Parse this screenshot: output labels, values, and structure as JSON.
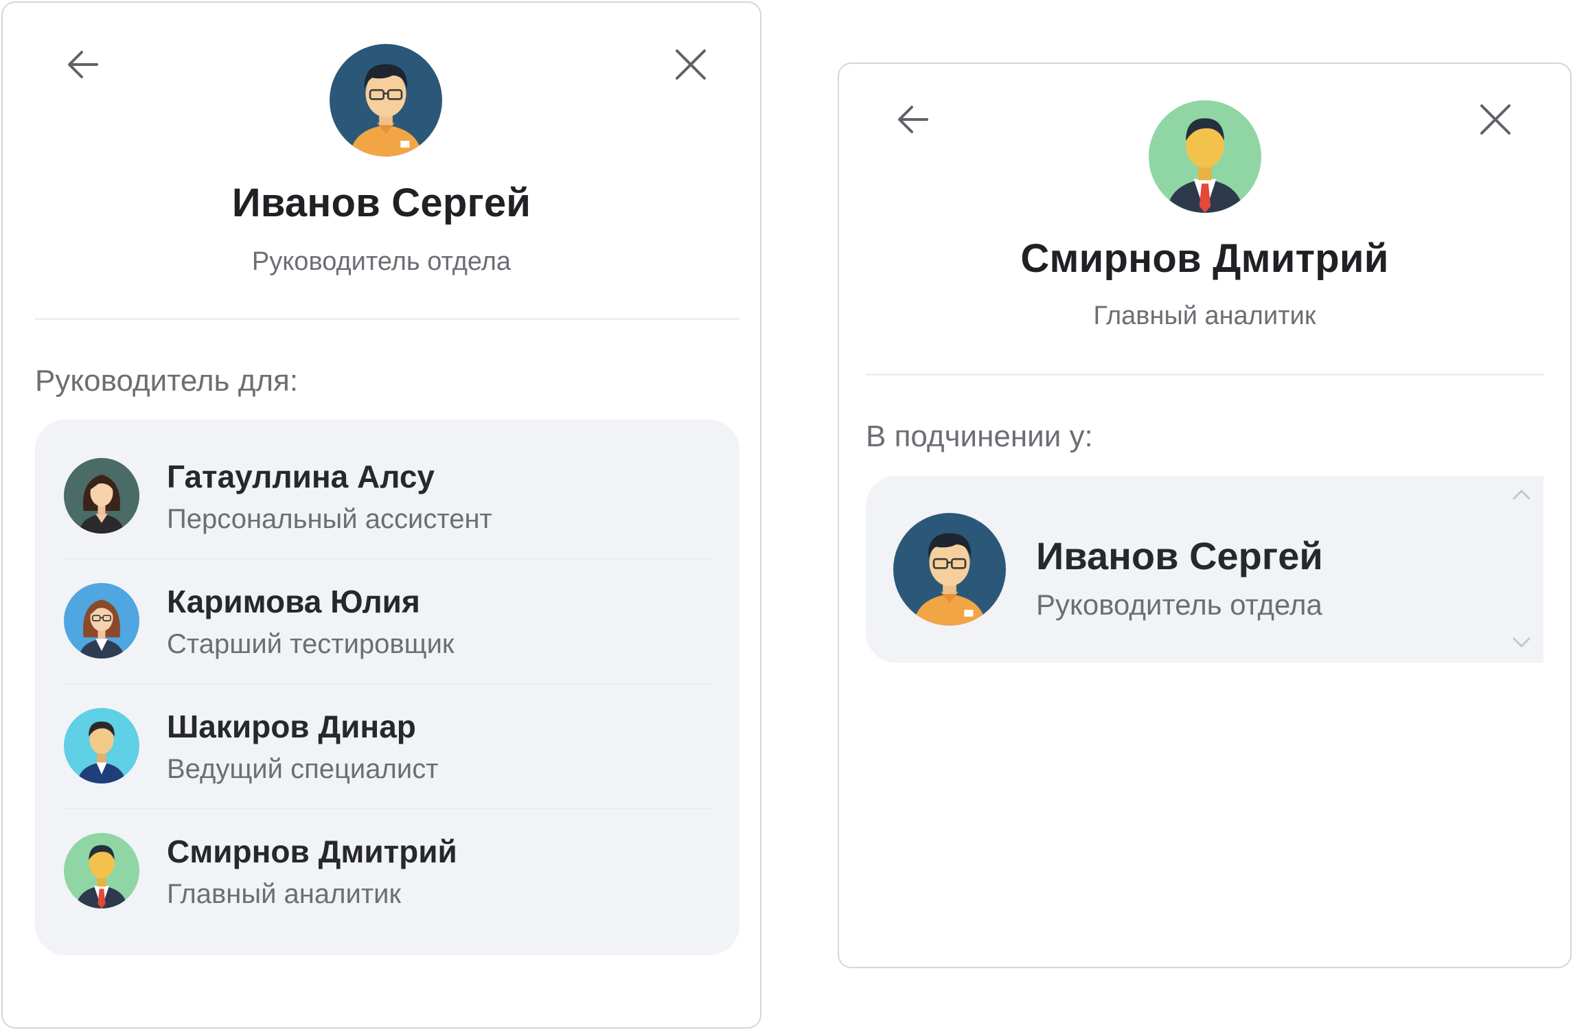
{
  "left_card": {
    "profile": {
      "name": "Иванов Сергей",
      "role": "Руководитель отдела",
      "avatar_icon": "man-glasses-orange-avatar"
    },
    "section_label": "Руководитель для:",
    "items": [
      {
        "name": "Гатауллина Алсу",
        "role": "Персональный ассистент",
        "avatar_icon": "woman-dark-hair-avatar"
      },
      {
        "name": "Каримова Юлия",
        "role": "Старший тестировщик",
        "avatar_icon": "woman-glasses-avatar"
      },
      {
        "name": "Шакиров Динар",
        "role": "Ведущий специалист",
        "avatar_icon": "man-blue-suit-avatar"
      },
      {
        "name": "Смирнов Дмитрий",
        "role": "Главный аналитик",
        "avatar_icon": "man-red-tie-avatar"
      }
    ],
    "back_icon": "arrow-left-icon",
    "close_icon": "close-icon"
  },
  "right_card": {
    "profile": {
      "name": "Смирнов Дмитрий",
      "role": "Главный аналитик",
      "avatar_icon": "man-red-tie-avatar"
    },
    "section_label": "В подчинении у:",
    "items": [
      {
        "name": "Иванов Сергей",
        "role": "Руководитель отдела",
        "avatar_icon": "man-glasses-orange-avatar"
      }
    ],
    "back_icon": "arrow-left-icon",
    "close_icon": "close-icon",
    "scroll_up_icon": "chevron-up-icon",
    "scroll_down_icon": "chevron-down-icon"
  },
  "colors": {
    "title_text": "#202124",
    "secondary_text": "#6b6e73",
    "panel_bg": "#f2f3f6",
    "border": "#d4d6da"
  }
}
